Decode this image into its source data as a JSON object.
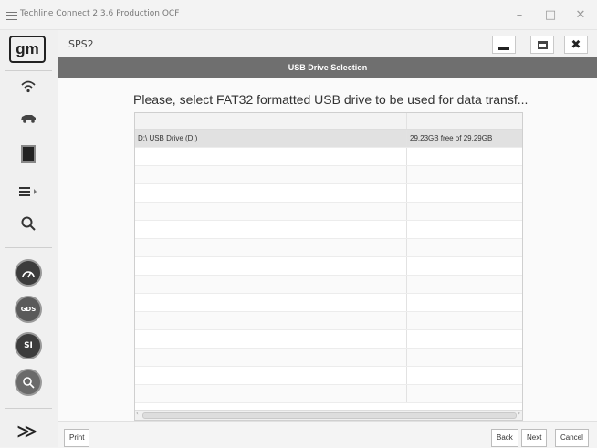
{
  "window": {
    "title": "Techline Connect 2.3.6 Production OCF",
    "minimize": "–",
    "maximize": "□",
    "close": "✕"
  },
  "sidebar": {
    "logo": "gm",
    "items": [
      "wifi-icon",
      "vehicle-icon",
      "module-icon",
      "list-icon",
      "search-icon",
      "gauge-icon",
      "gds-icon",
      "si-icon",
      "sps-icon"
    ],
    "si_label": "SI",
    "gds_label": "GDS",
    "expand": "≫"
  },
  "header": {
    "app_name": "SPS2"
  },
  "banner": {
    "title": "USB Drive Selection"
  },
  "prompt": "Please, select FAT32 formatted USB drive to be used for data transf...",
  "table": {
    "rows": [
      {
        "drive": "D:\\ USB Drive (D:)",
        "space": "29.23GB free of 29.29GB",
        "selected": true
      }
    ],
    "empty_rows": 14
  },
  "footer": {
    "print": "Print",
    "back": "Back",
    "next": "Next",
    "cancel": "Cancel"
  }
}
